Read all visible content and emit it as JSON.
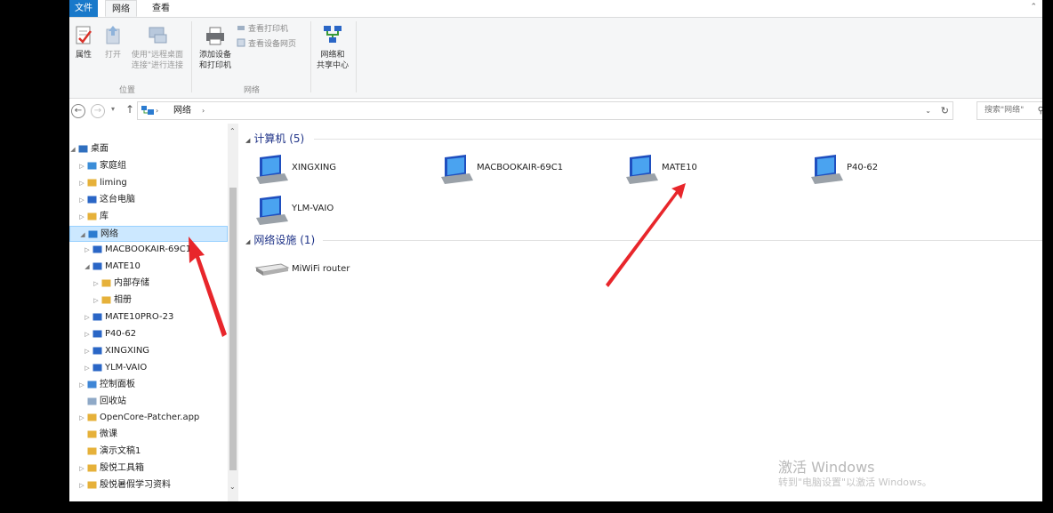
{
  "ribbon": {
    "tabs": [
      "文件",
      "网络",
      "查看"
    ],
    "buttons": {
      "properties": "属性",
      "open": "打开",
      "remote_desktop": [
        "使用\"远程桌面",
        "连接\"进行连接"
      ],
      "add_devices": [
        "添加设备",
        "和打印机"
      ],
      "view_printers": "查看打印机",
      "view_device_webpage": "查看设备网页",
      "network_center": [
        "网络和",
        "共享中心"
      ]
    },
    "groups": {
      "location": "位置",
      "network": "网络"
    }
  },
  "address": {
    "path_label": "网络",
    "search_placeholder": "搜索\"网络\""
  },
  "nav_tree": [
    {
      "label": "桌面",
      "level": 0,
      "exp": "◢",
      "icon": "desktop-icon",
      "color": "#2f6fbf"
    },
    {
      "label": "家庭组",
      "level": 1,
      "exp": "▷",
      "icon": "homegroup-icon",
      "color": "#3b8dd8"
    },
    {
      "label": "liming",
      "level": 1,
      "exp": "▷",
      "icon": "user-folder-icon",
      "color": "#e6b13a"
    },
    {
      "label": "这台电脑",
      "level": 1,
      "exp": "▷",
      "icon": "computer-icon",
      "color": "#2a66c6"
    },
    {
      "label": "库",
      "level": 1,
      "exp": "▷",
      "icon": "library-icon",
      "color": "#e6b13a"
    },
    {
      "label": "网络",
      "level": 1,
      "exp": "◢",
      "icon": "network-icon",
      "color": "#2a7bd0",
      "selected": true
    },
    {
      "label": "MACBOOKAIR-69C1",
      "level": 2,
      "exp": "▷",
      "icon": "computer-icon",
      "color": "#2a66c6"
    },
    {
      "label": "MATE10",
      "level": 2,
      "exp": "◢",
      "icon": "computer-icon",
      "color": "#2a66c6"
    },
    {
      "label": "内部存储",
      "level": 3,
      "exp": "▷",
      "icon": "folder-icon",
      "color": "#e6b13a"
    },
    {
      "label": "相册",
      "level": 3,
      "exp": "▷",
      "icon": "folder-icon",
      "color": "#e6b13a"
    },
    {
      "label": "MATE10PRO-23",
      "level": 2,
      "exp": "▷",
      "icon": "computer-icon",
      "color": "#2a66c6"
    },
    {
      "label": "P40-62",
      "level": 2,
      "exp": "▷",
      "icon": "computer-icon",
      "color": "#2a66c6"
    },
    {
      "label": "XINGXING",
      "level": 2,
      "exp": "▷",
      "icon": "computer-icon",
      "color": "#2a66c6"
    },
    {
      "label": "YLM-VAIO",
      "level": 2,
      "exp": "▷",
      "icon": "computer-icon",
      "color": "#2a66c6"
    },
    {
      "label": "控制面板",
      "level": 1,
      "exp": "▷",
      "icon": "control-panel-icon",
      "color": "#3f86d6"
    },
    {
      "label": "回收站",
      "level": 1,
      "exp": "",
      "icon": "recycle-bin-icon",
      "color": "#8fa9c7"
    },
    {
      "label": "OpenCore-Patcher.app",
      "level": 1,
      "exp": "▷",
      "icon": "folder-icon",
      "color": "#e6b13a"
    },
    {
      "label": "微课",
      "level": 1,
      "exp": "",
      "icon": "folder-icon",
      "color": "#e6b13a"
    },
    {
      "label": "演示文稿1",
      "level": 1,
      "exp": "",
      "icon": "folder-icon",
      "color": "#e6b13a"
    },
    {
      "label": "殷悦工具箱",
      "level": 1,
      "exp": "▷",
      "icon": "folder-icon",
      "color": "#e6b13a"
    },
    {
      "label": "殷悦暑假学习资料",
      "level": 1,
      "exp": "▷",
      "icon": "folder-icon",
      "color": "#e6b13a"
    }
  ],
  "content": {
    "computers_header": "计算机 (5)",
    "computers": [
      "XINGXING",
      "MACBOOKAIR-69C1",
      "MATE10",
      "P40-62",
      "YLM-VAIO"
    ],
    "devices_header": "网络设施 (1)",
    "devices": [
      "MiWiFi router"
    ]
  },
  "watermark": {
    "line1": "激活 Windows",
    "line2": "转到\"电脑设置\"以激活 Windows。"
  },
  "colors": {
    "accent": "#1979ca",
    "selection": "#cce8ff",
    "annotation_arrow": "#e8262b",
    "group_header": "#1e3287"
  }
}
